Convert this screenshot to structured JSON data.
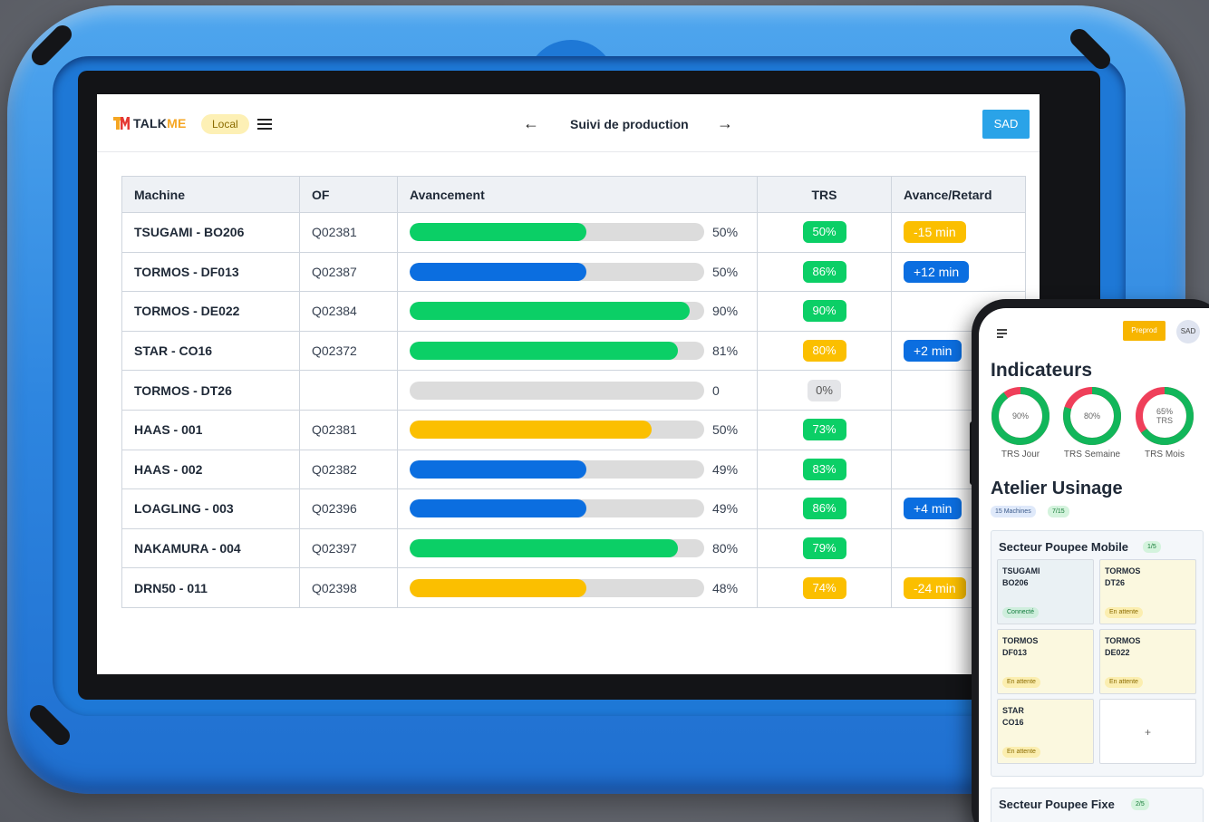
{
  "app": {
    "logo_prefix": "TALK",
    "logo_suffix": "ME",
    "env_badge": "Local",
    "page_title": "Suivi de production",
    "user_button": "SAD"
  },
  "colors": {
    "green": "#0bcf66",
    "blue": "#0b6ee0",
    "yellow": "#fbbf00",
    "gray": "#dcdcdc"
  },
  "table": {
    "headers": {
      "machine": "Machine",
      "of": "OF",
      "progress": "Avancement",
      "trs": "TRS",
      "delta": "Avance/Retard"
    },
    "rows": [
      {
        "machine": "TSUGAMI - BO206",
        "of": "Q02381",
        "progress": 0.6,
        "progress_label": "50%",
        "bar_color": "green",
        "trs": "50%",
        "trs_color": "green",
        "delta": "-15 min",
        "delta_color": "yellow"
      },
      {
        "machine": "TORMOS - DF013",
        "of": "Q02387",
        "progress": 0.6,
        "progress_label": "50%",
        "bar_color": "blue",
        "trs": "86%",
        "trs_color": "green",
        "delta": "+12 min",
        "delta_color": "blue"
      },
      {
        "machine": "TORMOS - DE022",
        "of": "Q02384",
        "progress": 0.95,
        "progress_label": "90%",
        "bar_color": "green",
        "trs": "90%",
        "trs_color": "green",
        "delta": "",
        "delta_color": ""
      },
      {
        "machine": "STAR - CO16",
        "of": "Q02372",
        "progress": 0.91,
        "progress_label": "81%",
        "bar_color": "green",
        "trs": "80%",
        "trs_color": "yellow",
        "delta": "+2 min",
        "delta_color": "blue"
      },
      {
        "machine": "TORMOS - DT26",
        "of": "",
        "progress": 0,
        "progress_label": "0",
        "bar_color": "gray",
        "trs": "0%",
        "trs_color": "gray",
        "delta": "",
        "delta_color": ""
      },
      {
        "machine": "HAAS - 001",
        "of": "Q02381",
        "progress": 0.82,
        "progress_label": "50%",
        "bar_color": "yellow",
        "trs": "73%",
        "trs_color": "green",
        "delta": "",
        "delta_color": ""
      },
      {
        "machine": "HAAS - 002",
        "of": "Q02382",
        "progress": 0.6,
        "progress_label": "49%",
        "bar_color": "blue",
        "trs": "83%",
        "trs_color": "green",
        "delta": "",
        "delta_color": ""
      },
      {
        "machine": "LOAGLING - 003",
        "of": "Q02396",
        "progress": 0.6,
        "progress_label": "49%",
        "bar_color": "blue",
        "trs": "86%",
        "trs_color": "green",
        "delta": "+4 min",
        "delta_color": "blue"
      },
      {
        "machine": "NAKAMURA - 004",
        "of": "Q02397",
        "progress": 0.91,
        "progress_label": "80%",
        "bar_color": "green",
        "trs": "79%",
        "trs_color": "green",
        "delta": "",
        "delta_color": ""
      },
      {
        "machine": "DRN50 - 011",
        "of": "Q02398",
        "progress": 0.6,
        "progress_label": "48%",
        "bar_color": "yellow",
        "trs": "74%",
        "trs_color": "yellow",
        "delta": "-24 min",
        "delta_color": "yellow"
      }
    ]
  },
  "mobile": {
    "env_button": "Preprod",
    "user_avatar": "SAD",
    "indicators_title": "Indicateurs",
    "gauges": [
      {
        "label": "TRS Jour",
        "value": "90%",
        "fraction": 0.9
      },
      {
        "label": "TRS Semaine",
        "value": "80%",
        "fraction": 0.8
      },
      {
        "label": "TRS Mois",
        "value": "65%",
        "value2": "TRS",
        "fraction": 0.65
      }
    ],
    "workshop_title": "Atelier Usinage",
    "workshop_machines": "15 Machines",
    "workshop_ratio": "7/15",
    "sector1": {
      "title": "Secteur Poupee Mobile",
      "count": "1/5",
      "cards": [
        {
          "line1": "TSUGAMI",
          "line2": "BO206",
          "status": "Connecté"
        },
        {
          "line1": "TORMOS",
          "line2": "DT26",
          "status": "En attente"
        },
        {
          "line1": "TORMOS",
          "line2": "DF013",
          "status": "En attente"
        },
        {
          "line1": "TORMOS",
          "line2": "DE022",
          "status": "En attente"
        },
        {
          "line1": "STAR",
          "line2": "CO16",
          "status": "En attente"
        }
      ],
      "add_label": "+"
    },
    "sector2": {
      "title": "Secteur Poupee Fixe",
      "count": "2/5"
    }
  }
}
